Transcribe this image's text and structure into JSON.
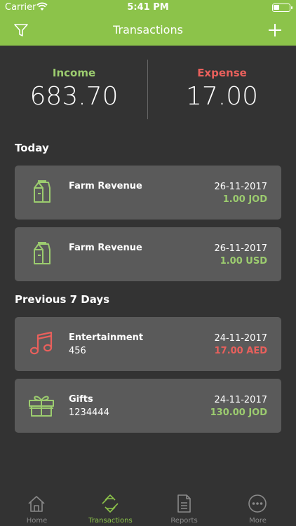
{
  "status_bar": {
    "carrier": "Carrier",
    "time": "5:41 PM"
  },
  "nav": {
    "title": "Transactions",
    "left_icon": "filter-icon",
    "right_icon": "plus-icon"
  },
  "summary": {
    "income_label": "Income",
    "income_value": "683.70",
    "expense_label": "Expense",
    "expense_value": "17.00"
  },
  "sections": [
    {
      "title": "Today",
      "items": [
        {
          "icon": "milk-carton-icon",
          "name": "Farm Revenue",
          "note": "",
          "date": "26-11-2017",
          "amount": "1.00 JOD",
          "type": "income"
        },
        {
          "icon": "milk-carton-icon",
          "name": "Farm Revenue",
          "note": "",
          "date": "26-11-2017",
          "amount": "1.00 USD",
          "type": "income"
        }
      ]
    },
    {
      "title": "Previous 7 Days",
      "items": [
        {
          "icon": "music-note-icon",
          "name": "Entertainment",
          "note": "456",
          "date": "24-11-2017",
          "amount": "17.00 AED",
          "type": "expense"
        },
        {
          "icon": "gift-icon",
          "name": "Gifts",
          "note": "1234444",
          "date": "24-11-2017",
          "amount": "130.00 JOD",
          "type": "income"
        }
      ]
    }
  ],
  "tabs": [
    {
      "label": "Home",
      "icon": "home-icon",
      "active": false
    },
    {
      "label": "Transactions",
      "icon": "transactions-icon",
      "active": true
    },
    {
      "label": "Reports",
      "icon": "reports-icon",
      "active": false
    },
    {
      "label": "More",
      "icon": "more-icon",
      "active": false
    }
  ],
  "colors": {
    "accent": "#8cc34a",
    "income": "#9ccc6f",
    "expense": "#e9605c",
    "background": "#333333",
    "card": "#5a5a5a"
  }
}
